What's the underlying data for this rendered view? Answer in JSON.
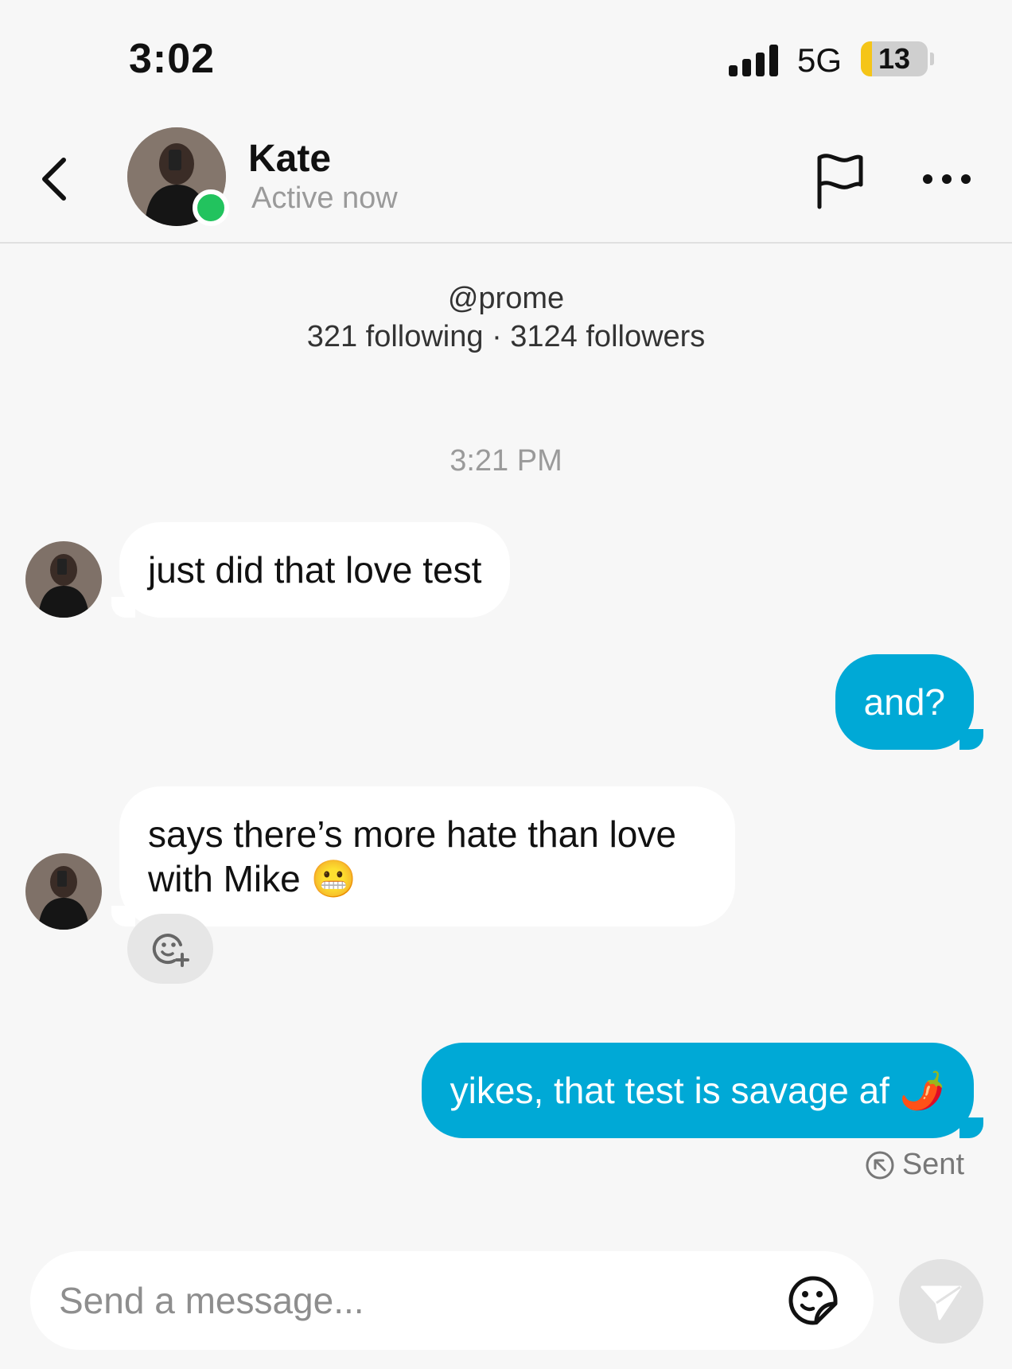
{
  "status_bar": {
    "time": "3:02",
    "network": "5G",
    "battery_level": "13"
  },
  "header": {
    "name": "Kate",
    "status": "Active now"
  },
  "profile": {
    "handle": "@prome",
    "stats": "321 following · 3124 followers"
  },
  "conversation": {
    "timestamp": "3:21 PM",
    "messages": [
      {
        "from": "them",
        "text": "just did that love test"
      },
      {
        "from": "me",
        "text": "and?"
      },
      {
        "from": "them",
        "line1": "says there’s more hate than love",
        "line2": "with Mike",
        "emoji": "😬"
      },
      {
        "from": "me",
        "text": "yikes, that test is savage af",
        "emoji": "🌶️"
      }
    ],
    "sent_status": "Sent"
  },
  "composer": {
    "placeholder": "Send a message..."
  },
  "colors": {
    "outgoing_bubble": "#00a9d6",
    "online": "#22c35e",
    "battery_accent": "#f5c518"
  },
  "icons": [
    "back-chevron-icon",
    "flag-icon",
    "more-dots-icon",
    "add-reaction-icon",
    "sent-arrow-icon",
    "sticker-icon",
    "send-icon"
  ]
}
